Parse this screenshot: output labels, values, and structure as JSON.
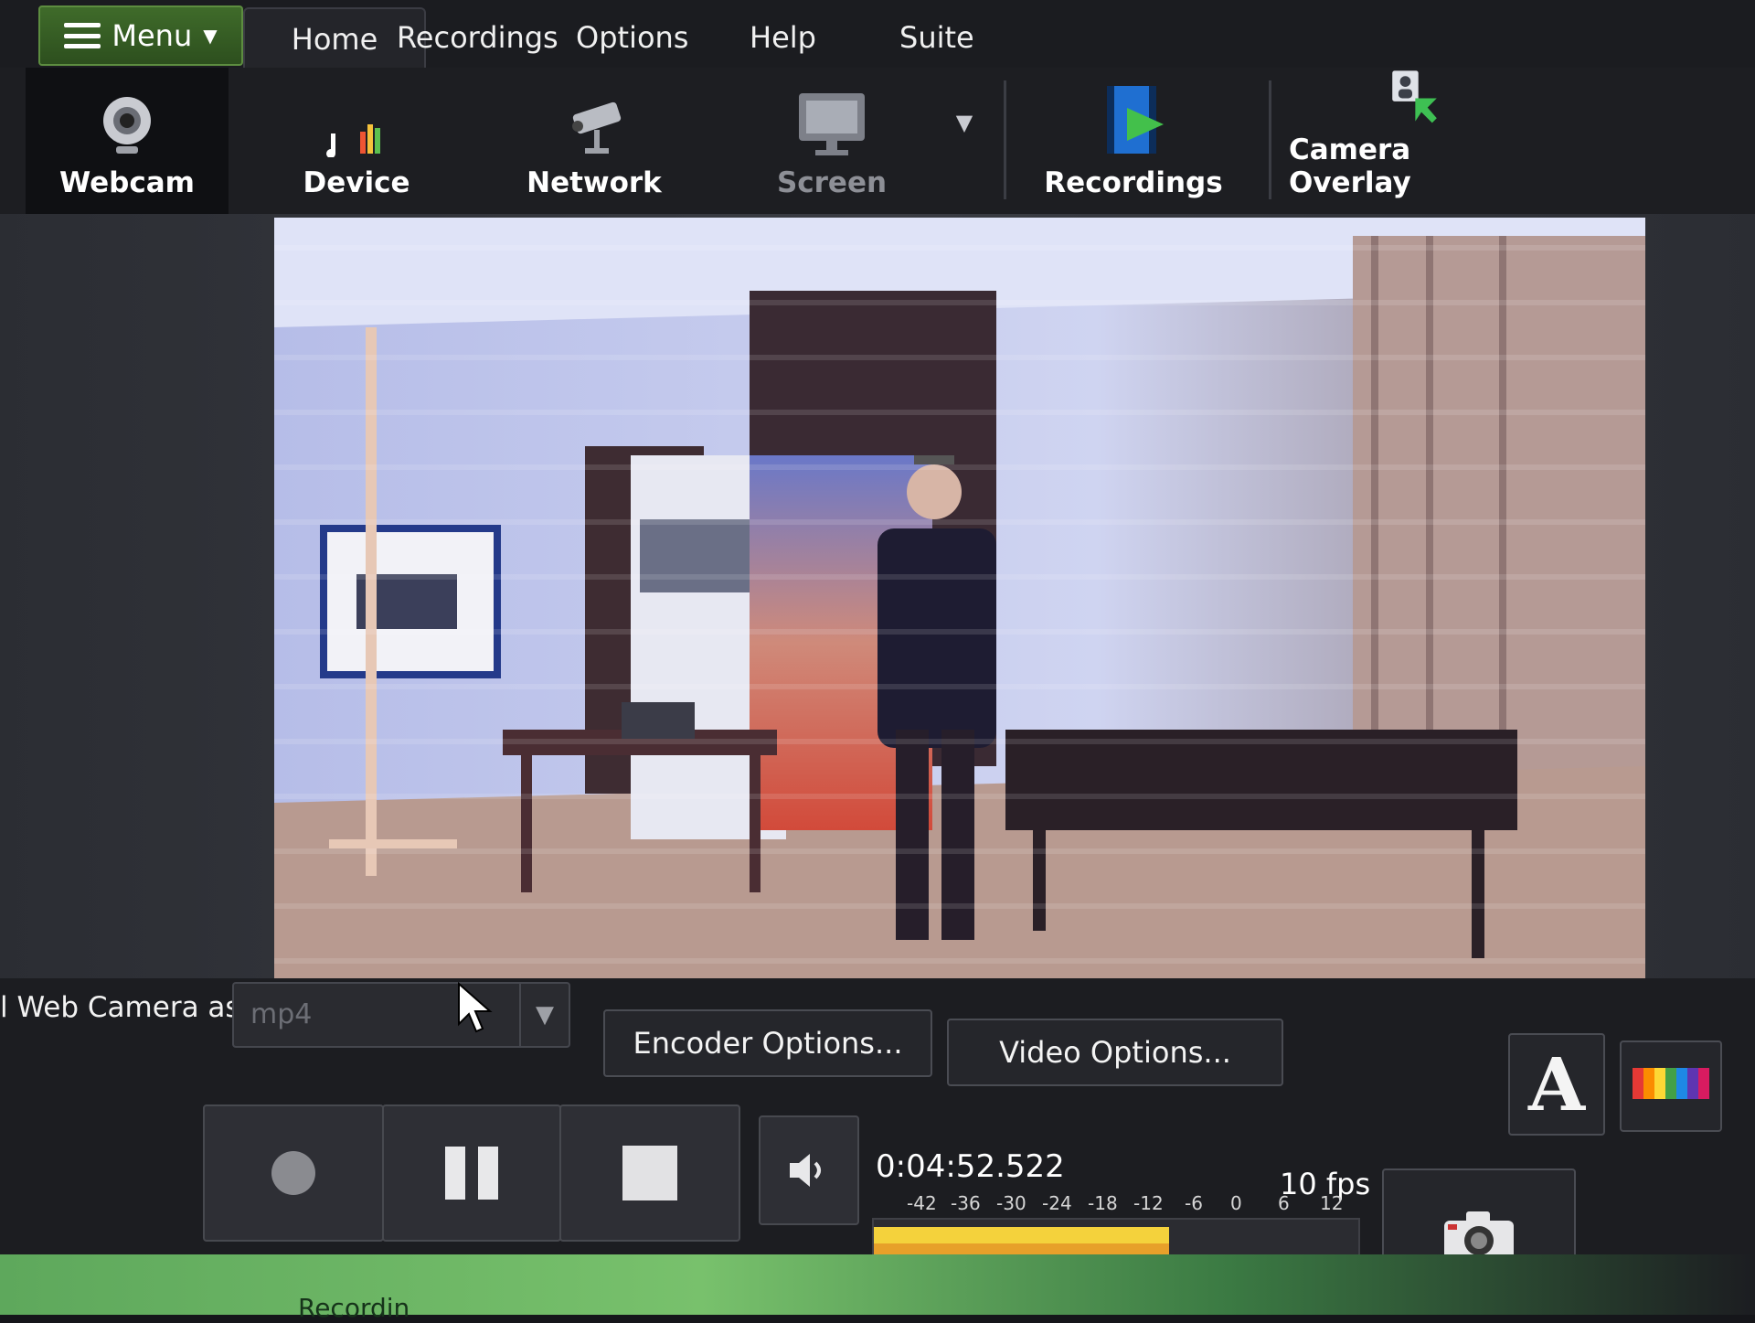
{
  "menubar": {
    "menu_label": "Menu",
    "tabs": [
      {
        "label": "Home",
        "active": true
      },
      {
        "label": "Recordings",
        "active": false
      },
      {
        "label": "Options",
        "active": false
      },
      {
        "label": "Help",
        "active": false
      },
      {
        "label": "Suite",
        "active": false
      }
    ]
  },
  "toolbar": {
    "items": [
      {
        "label": "Webcam",
        "icon": "webcam-icon",
        "state": "selected"
      },
      {
        "label": "Device",
        "icon": "device-icon",
        "state": "normal"
      },
      {
        "label": "Network",
        "icon": "network-camera-icon",
        "state": "normal"
      },
      {
        "label": "Screen",
        "icon": "monitor-icon",
        "state": "disabled"
      },
      {
        "label": "Recordings",
        "icon": "film-play-icon",
        "state": "normal"
      },
      {
        "label": "Camera Overlay",
        "icon": "camera-overlay-icon",
        "state": "normal"
      }
    ]
  },
  "controls": {
    "save_label": "l Web Camera as:",
    "format_value": "mp4",
    "encoder_options": "Encoder Options...",
    "video_options": "Video Options...",
    "text_overlay_glyph": "A",
    "timer": "0:04:52.522",
    "fps": "10 fps",
    "meter_scale": [
      "-42",
      "-36",
      "-30",
      "-24",
      "-18",
      "-12",
      "-6",
      "0",
      "6",
      "12"
    ],
    "meter_level": 0.61,
    "status_text": "Recordin"
  },
  "colors": {
    "accent_green": "#3f6b2a",
    "meter_yellow": "#f4d23c",
    "meter_orange": "#e7a02a"
  }
}
